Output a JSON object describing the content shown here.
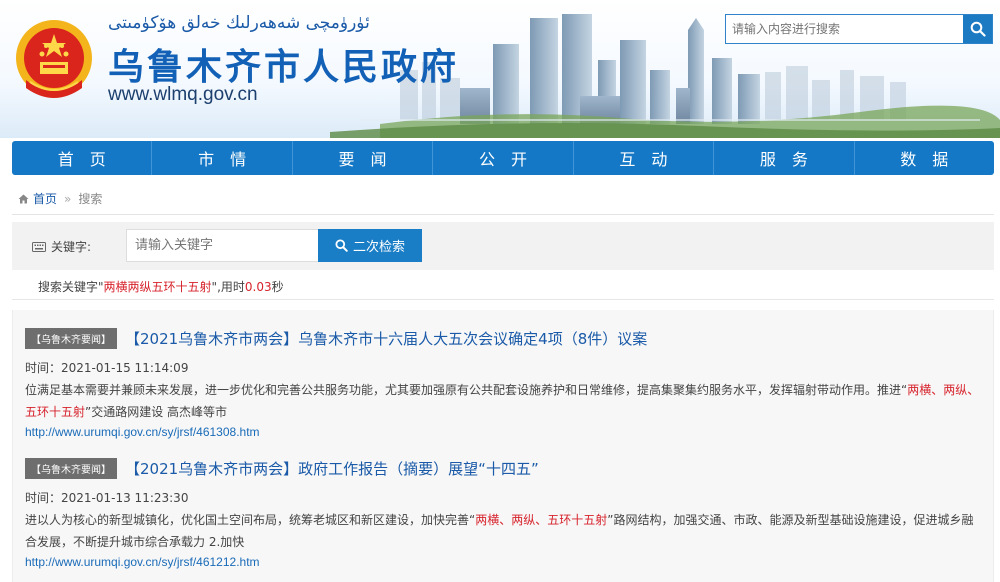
{
  "header": {
    "uyghur_title": "ئۈرۈمچى شەھەرلىك خەلق ھۆكۈمىتى",
    "site_title": "乌鲁木齐市人民政府",
    "site_url": "www.wlmq.gov.cn",
    "search_placeholder": "请输入内容进行搜索"
  },
  "nav": {
    "items": [
      "首页",
      "市情",
      "要闻",
      "公开",
      "互动",
      "服务",
      "数据"
    ]
  },
  "breadcrumb": {
    "home": "首页",
    "separator": "»",
    "current": "搜索"
  },
  "filter": {
    "keyword_label": "关键字:",
    "keyword_placeholder": "请输入关键字",
    "secondary_search_label": "二次检索"
  },
  "stats": {
    "prefix": "搜索关键字\"",
    "keyword": "两横两纵五环十五射",
    "middle": "\",用时",
    "time": "0.03",
    "unit": "秒"
  },
  "results": [
    {
      "tag": "【乌鲁木齐要闻】",
      "title": "【2021乌鲁木齐市两会】乌鲁木齐市十六届人大五次会议确定4项（8件）议案",
      "time": "时间：2021-01-15 11:14:09",
      "desc_before": "位满足基本需要并兼顾未来发展，进一步优化和完善公共服务功能，尤其要加强原有公共配套设施养护和日常维修，提高集聚集约服务水平，发挥辐射带动作用。推进“",
      "desc_highlight": "两横、两纵、五环十五射",
      "desc_after": "”交通路网建设 高杰峰等市",
      "url": "http://www.urumqi.gov.cn/sy/jrsf/461308.htm"
    },
    {
      "tag": "【乌鲁木齐要闻】",
      "title": "【2021乌鲁木齐市两会】政府工作报告（摘要）展望“十四五”",
      "time": "时间：2021-01-13 11:23:30",
      "desc_before": "进以人为核心的新型城镇化，优化国土空间布局，统筹老城区和新区建设，加快完善“",
      "desc_highlight": "两横、两纵、五环十五射",
      "desc_after": "”路网结构，加强交通、市政、能源及新型基础设施建设，促进城乡融合发展，不断提升城市综合承载力 2.加快",
      "url": "http://www.urumqi.gov.cn/sy/jrsf/461212.htm"
    }
  ],
  "colors": {
    "brand_blue": "#1478c6",
    "highlight_red": "#d7232c",
    "tag_gray": "#6e6e6e"
  }
}
